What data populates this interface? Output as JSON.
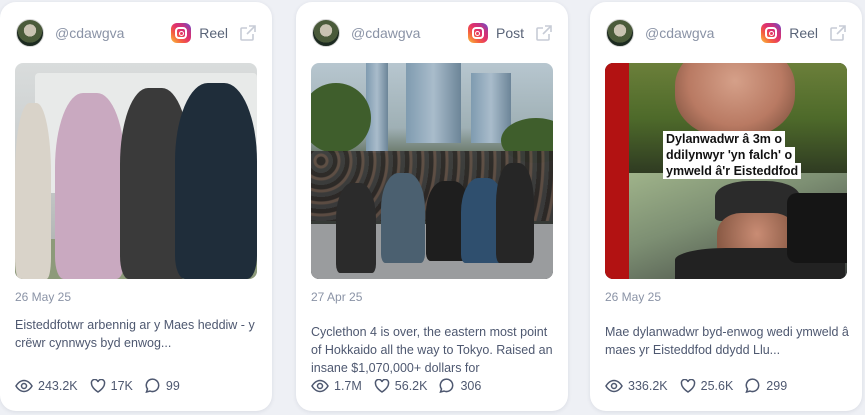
{
  "cards": [
    {
      "handle": "@cdawgva",
      "platform_icon": "instagram-icon",
      "post_type": "Post",
      "date": "27 Apr 25",
      "caption": "Cyclethon 4 is over, the eastern most point of Hokkaido all the way to Tokyo. Raised an insane $1,070,000+ dollars for",
      "views": "1.7M",
      "likes": "56.2K",
      "comments": "306"
    },
    {
      "handle": "@cdawgva",
      "platform_icon": "instagram-icon",
      "post_type": "Reel",
      "date": "26 May 25",
      "overlay_text": "Dylanwadwr â 3m o ddilynwyr 'yn falch' o ymweld â'r Eisteddfod",
      "caption": "Mae dylanwadwr byd-enwog wedi ymweld â maes yr Eisteddfod ddydd Llu...",
      "views": "336.2K",
      "likes": "25.6K",
      "comments": "299"
    },
    {
      "handle": "@cdawgva",
      "platform_icon": "instagram-icon",
      "post_type": "Reel",
      "date": "26 May 25",
      "caption": "Eisteddfotwr arbennig ar y Maes heddiw - y crëwr cynnwys byd enwog...",
      "views": "243.2K",
      "likes": "17K",
      "comments": "99"
    }
  ]
}
